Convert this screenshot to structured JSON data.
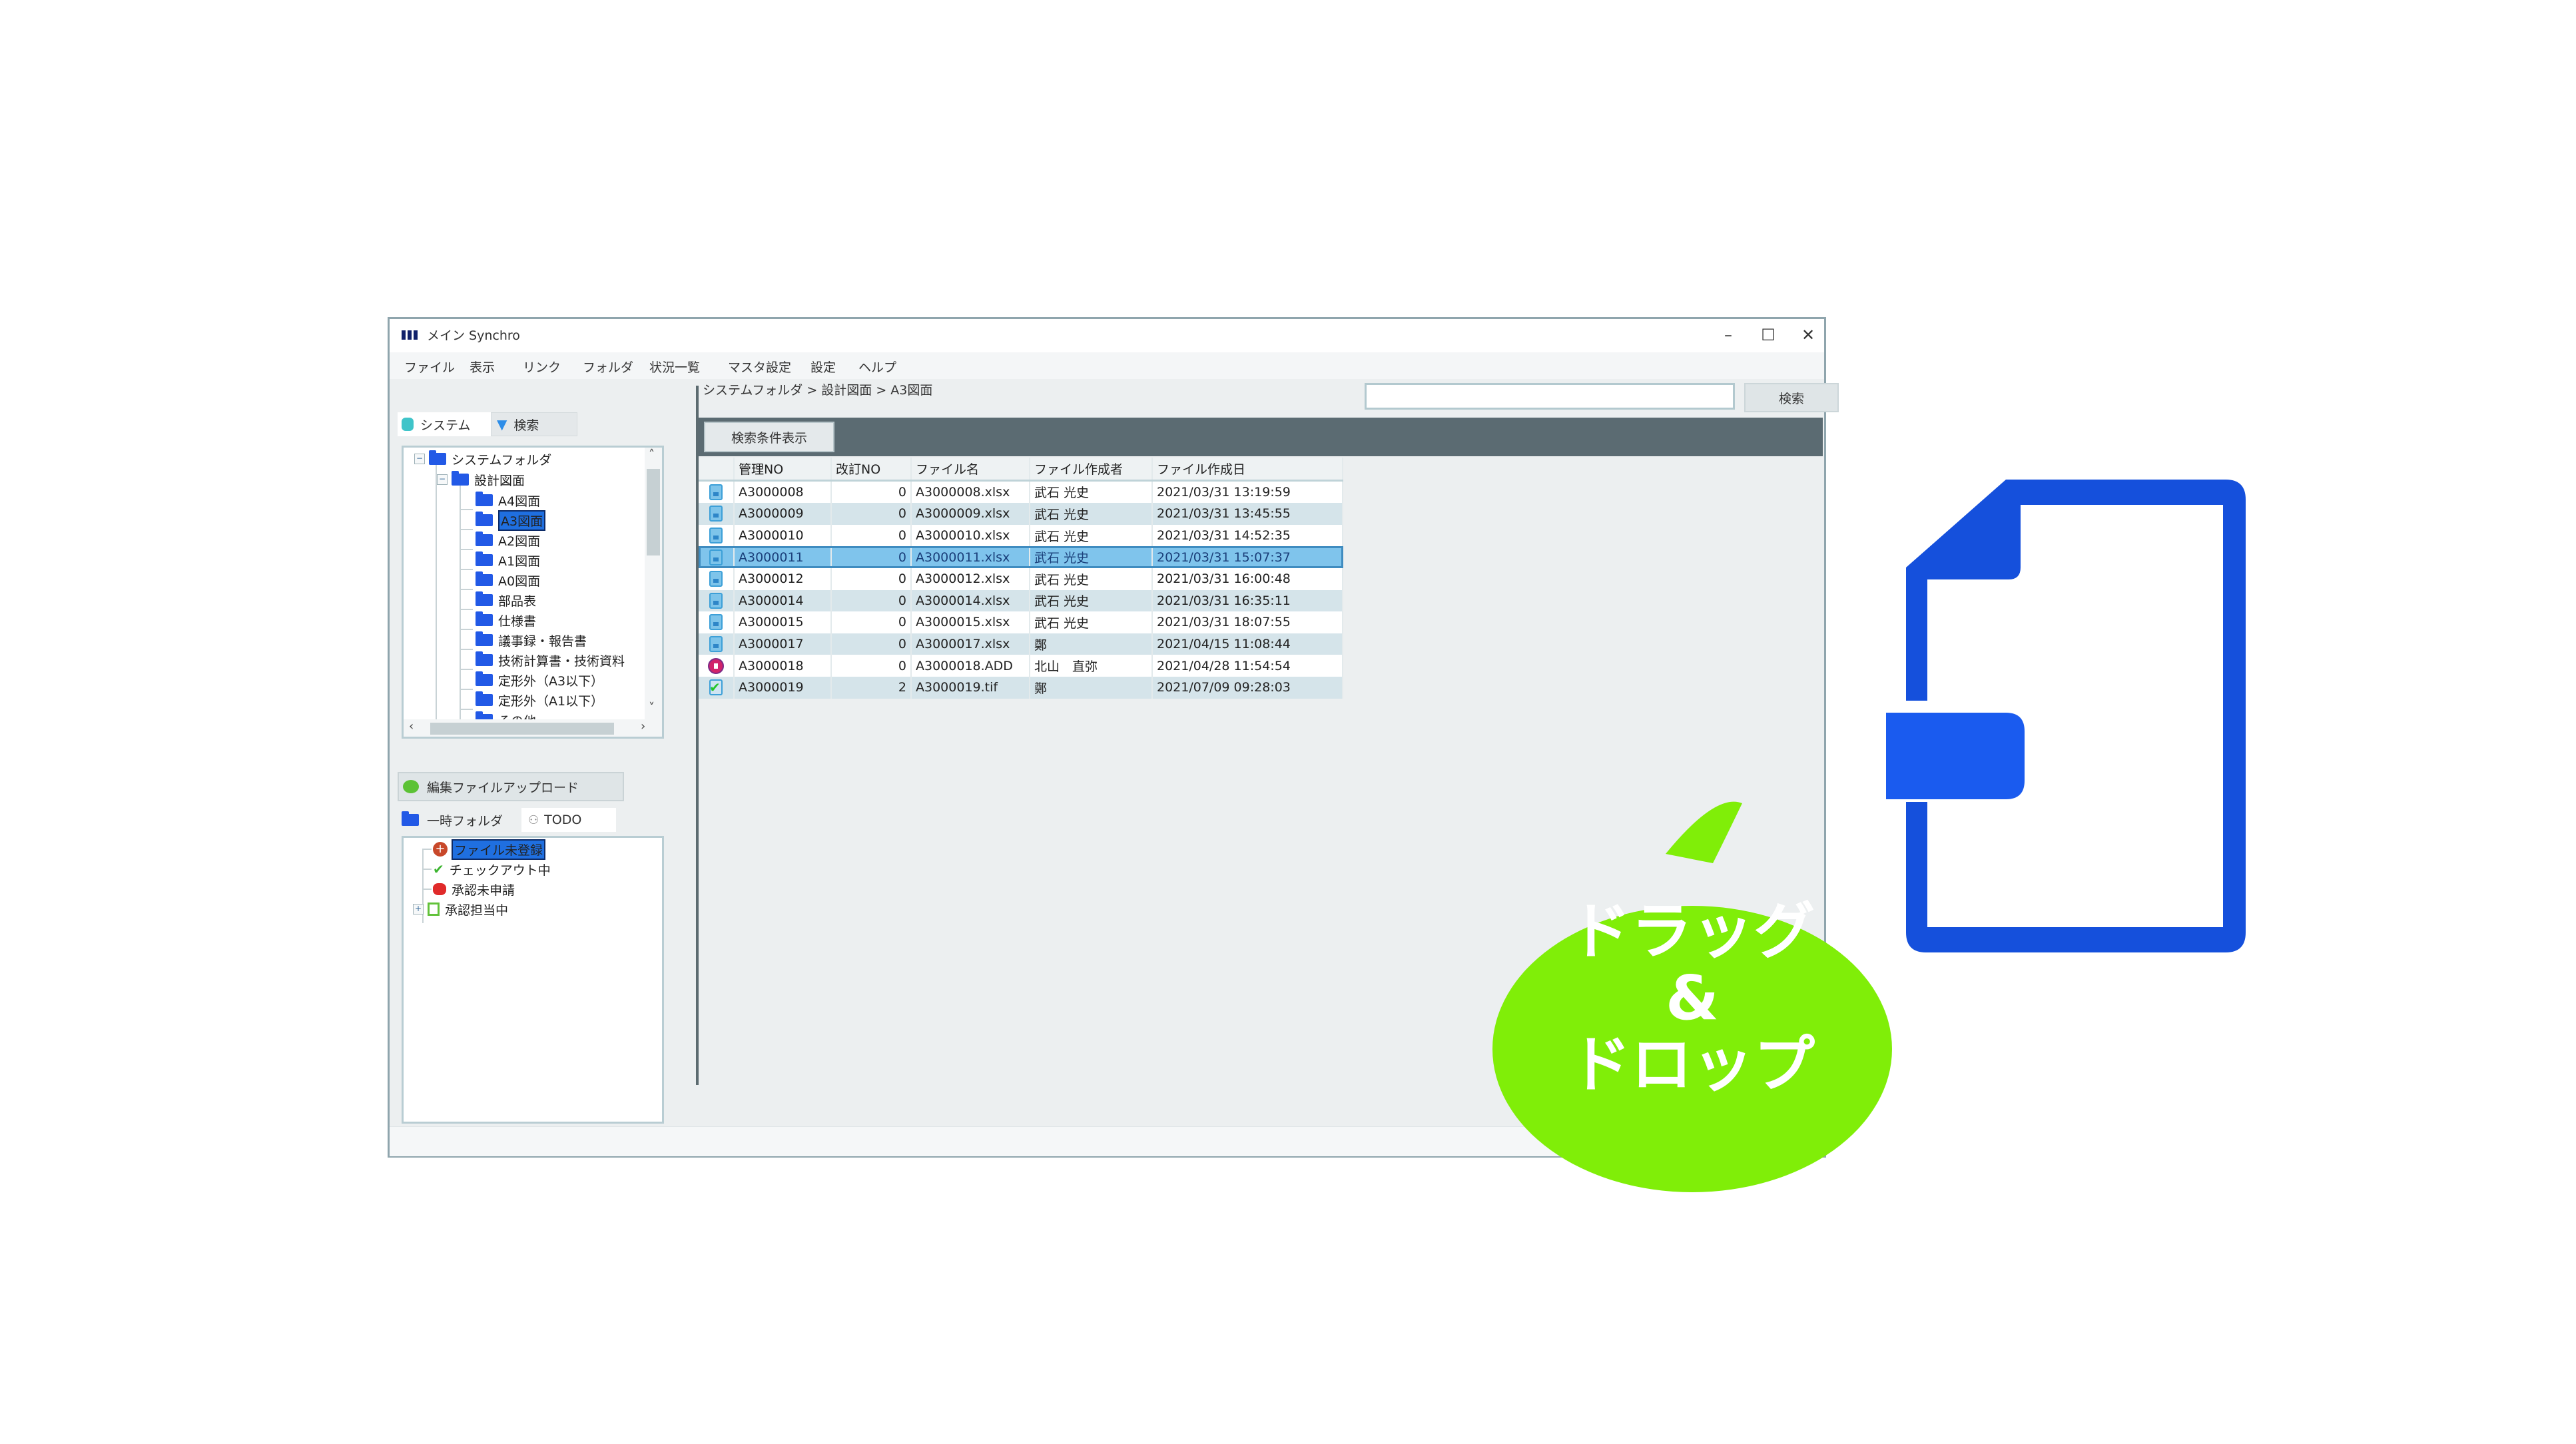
{
  "window": {
    "title": "メイン Synchro",
    "controls": {
      "minimize": "–",
      "maximize": "☐",
      "close": "✕"
    }
  },
  "menu": [
    "ファイル",
    "表示",
    "リンク",
    "フォルダ",
    "状況一覧",
    "マスタ設定",
    "設定",
    "ヘルプ"
  ],
  "left_tabs": [
    {
      "label": "システム",
      "icon": "database-icon",
      "active": true
    },
    {
      "label": "検索",
      "icon": "filter-icon",
      "active": false
    }
  ],
  "tree": {
    "root": "システムフォルダ",
    "child": "設計図面",
    "items": [
      "A4図面",
      "A3図面",
      "A2図面",
      "A1図面",
      "A0図面",
      "部品表",
      "仕様書",
      "議事録・報告書",
      "技術計算書・技術資料",
      "定形外（A3以下）",
      "定形外（A1以下）",
      "その他"
    ],
    "selected": "A3図面"
  },
  "upload_button": "編集ファイルアップロード",
  "bottom_tabs": [
    {
      "label": "一時フォルダ",
      "icon": "folder-icon",
      "active": false
    },
    {
      "label": "TODO",
      "icon": "user-icon",
      "active": true
    }
  ],
  "todo_items": [
    {
      "label": "ファイル未登録",
      "icon": "add-circle-icon",
      "selected": true
    },
    {
      "label": "チェックアウト中",
      "icon": "check-icon",
      "selected": false
    },
    {
      "label": "承認未申請",
      "icon": "stamp-icon",
      "selected": false
    },
    {
      "label": "承認担当中",
      "icon": "approval-icon",
      "selected": false,
      "expandable": true
    }
  ],
  "breadcrumb": "システムフォルダ > 設計図面 > A3図面",
  "search": {
    "value": "",
    "placeholder": "",
    "button": "検索"
  },
  "filter_button": "検索条件表示",
  "grid": {
    "columns": [
      "",
      "管理NO",
      "改訂NO",
      "ファイル名",
      "ファイル作成者",
      "ファイル作成日"
    ],
    "rows": [
      {
        "type": "xlsx",
        "no": "A3000008",
        "rev": "0",
        "file": "A3000008.xlsx",
        "author": "武石 光史",
        "date": "2021/03/31 13:19:59"
      },
      {
        "type": "xlsx",
        "no": "A3000009",
        "rev": "0",
        "file": "A3000009.xlsx",
        "author": "武石 光史",
        "date": "2021/03/31 13:45:55"
      },
      {
        "type": "xlsx",
        "no": "A3000010",
        "rev": "0",
        "file": "A3000010.xlsx",
        "author": "武石 光史",
        "date": "2021/03/31 14:52:35"
      },
      {
        "type": "xlsx",
        "no": "A3000011",
        "rev": "0",
        "file": "A3000011.xlsx",
        "author": "武石 光史",
        "date": "2021/03/31 15:07:37",
        "selected": true
      },
      {
        "type": "xlsx",
        "no": "A3000012",
        "rev": "0",
        "file": "A3000012.xlsx",
        "author": "武石 光史",
        "date": "2021/03/31 16:00:48"
      },
      {
        "type": "xlsx",
        "no": "A3000014",
        "rev": "0",
        "file": "A3000014.xlsx",
        "author": "武石 光史",
        "date": "2021/03/31 16:35:11"
      },
      {
        "type": "xlsx",
        "no": "A3000015",
        "rev": "0",
        "file": "A3000015.xlsx",
        "author": "武石 光史",
        "date": "2021/03/31 18:07:55"
      },
      {
        "type": "xlsx",
        "no": "A3000017",
        "rev": "0",
        "file": "A3000017.xlsx",
        "author": "鄭",
        "date": "2021/04/15 11:08:44"
      },
      {
        "type": "add",
        "no": "A3000018",
        "rev": "0",
        "file": "A3000018.ADD",
        "author": "北山　直弥",
        "date": "2021/04/28 11:54:54"
      },
      {
        "type": "tif",
        "no": "A3000019",
        "rev": "2",
        "file": "A3000019.tif",
        "author": "鄭",
        "date": "2021/07/09 09:28:03"
      }
    ]
  },
  "callout": {
    "lines": [
      "ドラッグ",
      "&",
      "ドロップ"
    ],
    "color": "#80ee08"
  },
  "overlay_icon": {
    "name": "file-import-icon",
    "color": "#1550dc"
  }
}
